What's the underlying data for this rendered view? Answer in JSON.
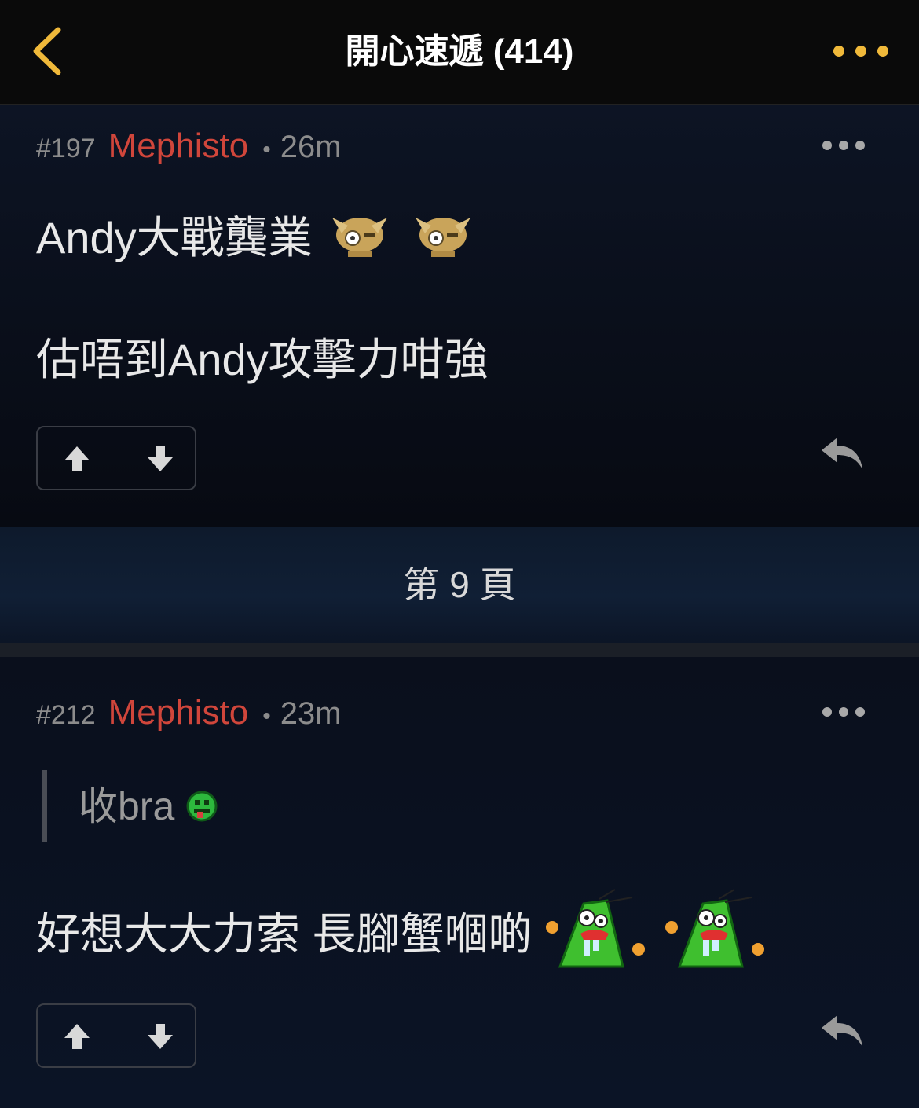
{
  "header": {
    "title": "開心速遞 (414)",
    "accent_color": "#f0b93a",
    "back_icon": "chevron-left-icon",
    "more_icon": "more-horizontal-icon"
  },
  "posts": [
    {
      "number": "#197",
      "author": "Mephisto",
      "separator": "•",
      "time": "26m",
      "author_color": "#d0463b",
      "lines": [
        "Andy大戰龔業",
        "估唔到Andy攻擊力咁強"
      ],
      "line1_emojis": [
        "golden-creature-emoji",
        "golden-creature-emoji"
      ]
    },
    {
      "number": "#212",
      "author": "Mephisto",
      "separator": "•",
      "time": "23m",
      "author_color": "#d0463b",
      "quote": "收bra",
      "quote_emoji": "green-face-emoji",
      "lines": [
        "好想大大力索 長腳蟹嗰啲"
      ],
      "line1_emojis": [
        "green-monster-emoji",
        "green-monster-emoji"
      ]
    }
  ],
  "page_divider": {
    "label": "第 9 頁"
  }
}
